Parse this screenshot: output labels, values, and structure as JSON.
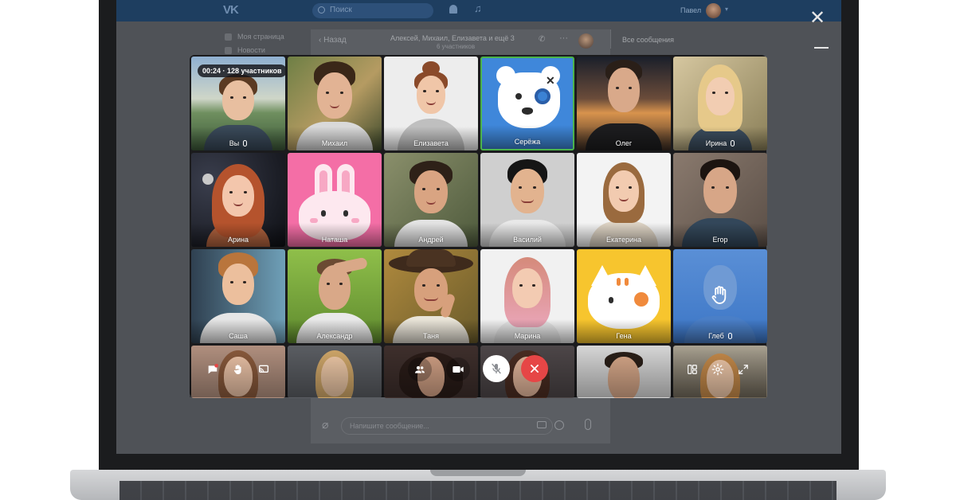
{
  "vk_header": {
    "logo": "VK",
    "search_placeholder": "Поиск",
    "user_name": "Павел"
  },
  "left_menu": {
    "items": [
      "Моя страница",
      "Новости"
    ]
  },
  "chat": {
    "back_label": "Назад",
    "title": "Алексей, Михаил, Елизавета и ещё 3",
    "subtitle": "6 участников",
    "right_panel_label": "Все сообщения",
    "composer_placeholder": "Напишите сообщение..."
  },
  "call": {
    "timer": "00:24 · 128 участников",
    "participants": [
      {
        "name": "Вы",
        "muted": true
      },
      {
        "name": "Михаил",
        "muted": false
      },
      {
        "name": "Елизавета",
        "muted": false
      },
      {
        "name": "Серёжа",
        "muted": false
      },
      {
        "name": "Олег",
        "muted": false
      },
      {
        "name": "Ирина",
        "muted": true
      },
      {
        "name": "Арина",
        "muted": false
      },
      {
        "name": "Наташа",
        "muted": false
      },
      {
        "name": "Андрей",
        "muted": false
      },
      {
        "name": "Василий",
        "muted": false
      },
      {
        "name": "Екатерина",
        "muted": false
      },
      {
        "name": "Егор",
        "muted": false
      },
      {
        "name": "Саша",
        "muted": false
      },
      {
        "name": "Александр",
        "muted": false
      },
      {
        "name": "Таня",
        "muted": false
      },
      {
        "name": "Марина",
        "muted": false
      },
      {
        "name": "Гена",
        "muted": false
      },
      {
        "name": "Глеб",
        "muted": true
      }
    ]
  },
  "colors": {
    "accent_blue": "#2f7fd6",
    "speaking_border": "#4bb34b",
    "end_call": "#e64646",
    "vk_header": "#1e3e60"
  },
  "icons": {
    "close": "close-icon",
    "minimize": "minimize-icon",
    "chat": "chat-icon",
    "raise_hand": "raise-hand-icon",
    "screen_share": "screen-share-icon",
    "participants": "participants-icon",
    "camera": "camera-icon",
    "microphone": "microphone-icon",
    "end_call": "end-call-icon",
    "layout": "layout-icon",
    "settings": "settings-icon",
    "fullscreen": "fullscreen-icon"
  }
}
